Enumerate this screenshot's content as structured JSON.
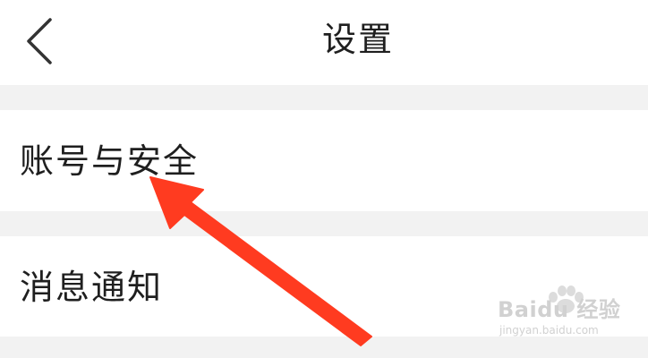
{
  "header": {
    "title": "设置",
    "back_icon": "chevron-left-icon"
  },
  "settings": {
    "items": [
      {
        "label": "账号与安全"
      },
      {
        "label": "消息通知"
      }
    ]
  },
  "colors": {
    "background": "#ffffff",
    "section_gap": "#f2f2f2",
    "text": "#1f1f1f",
    "annotation_arrow": "#ff3b20"
  },
  "watermark": {
    "main": "Baidu 经验",
    "sub": "jingyan.baidu.com"
  }
}
